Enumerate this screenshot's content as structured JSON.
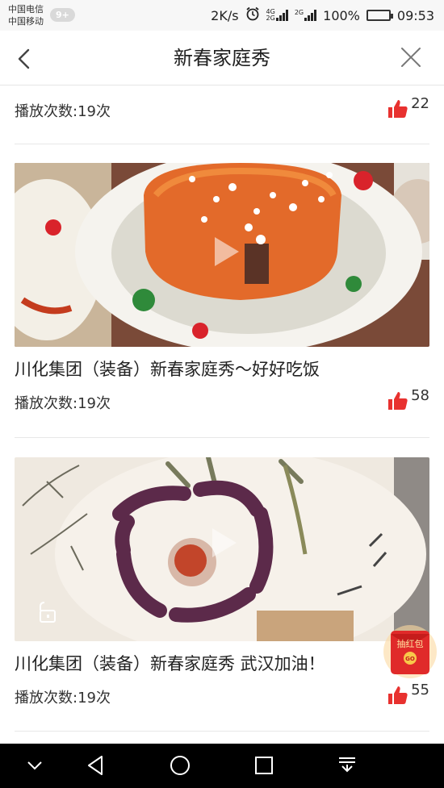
{
  "status_bar": {
    "carrier_1": "中国电信",
    "carrier_2": "中国移动",
    "notification_badge": "9+",
    "net_speed": "2K/s",
    "signal_label_1": "4G",
    "signal_label_1b": "2G",
    "signal_label_2": "2G",
    "battery_percent": "100%",
    "time": "09:53",
    "battery_level": 1.0
  },
  "header": {
    "title": "新春家庭秀",
    "back_icon": "chevron-left-icon",
    "close_icon": "close-icon"
  },
  "items": [
    {
      "play_count": "播放次数:19次",
      "likes": "22"
    },
    {
      "title": "川化集团（装备）新春家庭秀～好好吃饭",
      "play_count": "播放次数:19次",
      "likes": "58"
    },
    {
      "title": "川化集团（装备）新春家庭秀 武汉加油！",
      "play_count": "播放次数:19次",
      "likes": "55"
    }
  ],
  "floating": {
    "red_envelope_text": "抽红包",
    "red_envelope_go": "GO"
  },
  "colors": {
    "like_red": "#e8312f",
    "accent_green": "#2ecc40"
  }
}
